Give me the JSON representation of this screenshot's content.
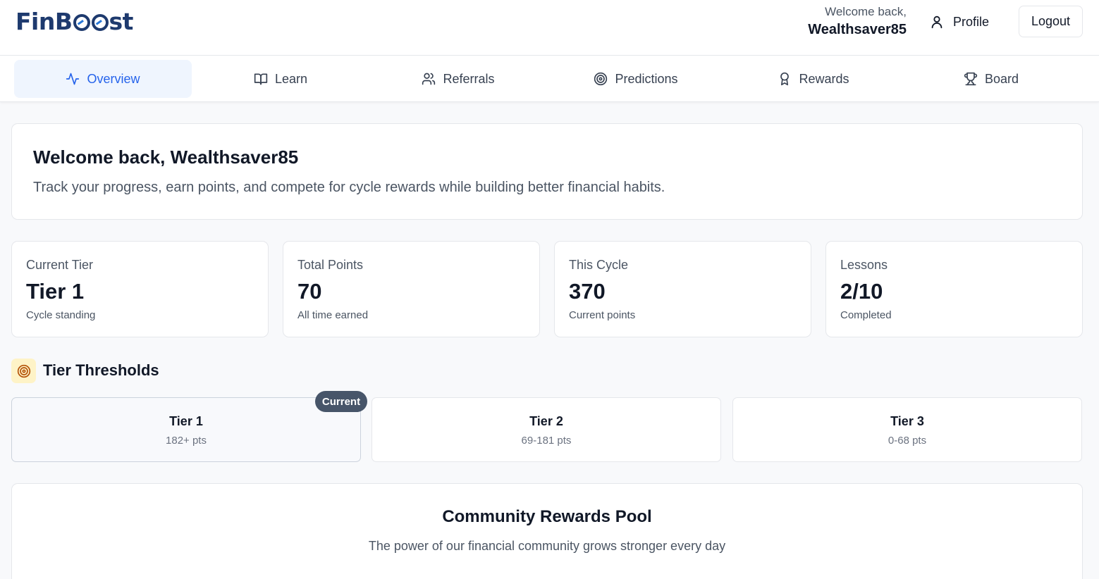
{
  "header": {
    "logo_text": "FinBoost",
    "welcome_label": "Welcome back,",
    "username": "Wealthsaver85",
    "profile_label": "Profile",
    "logout_label": "Logout"
  },
  "tabs": [
    {
      "label": "Overview",
      "icon": "activity-icon",
      "active": true
    },
    {
      "label": "Learn",
      "icon": "book-open-icon",
      "active": false
    },
    {
      "label": "Referrals",
      "icon": "users-icon",
      "active": false
    },
    {
      "label": "Predictions",
      "icon": "target-icon",
      "active": false
    },
    {
      "label": "Rewards",
      "icon": "award-icon",
      "active": false
    },
    {
      "label": "Board",
      "icon": "trophy-icon",
      "active": false
    }
  ],
  "welcome": {
    "title": "Welcome back, Wealthsaver85",
    "subtitle": "Track your progress, earn points, and compete for cycle rewards while building better financial habits."
  },
  "stats": [
    {
      "label": "Current Tier",
      "value": "Tier 1",
      "sub": "Cycle standing"
    },
    {
      "label": "Total Points",
      "value": "70",
      "sub": "All time earned"
    },
    {
      "label": "This Cycle",
      "value": "370",
      "sub": "Current points"
    },
    {
      "label": "Lessons",
      "value": "2/10",
      "sub": "Completed"
    }
  ],
  "tier_thresholds": {
    "title": "Tier Thresholds",
    "icon": "target-icon",
    "current_badge": "Current",
    "tiers": [
      {
        "name": "Tier 1",
        "points": "182+ pts",
        "current": true
      },
      {
        "name": "Tier 2",
        "points": "69-181 pts",
        "current": false
      },
      {
        "name": "Tier 3",
        "points": "0-68 pts",
        "current": false
      }
    ]
  },
  "community_pool": {
    "title": "Community Rewards Pool",
    "subtitle": "The power of our financial community grows stronger every day"
  },
  "colors": {
    "brand": "#1e3a6e",
    "accent": "#2563eb",
    "active_tab_bg": "#eff5fe",
    "badge_bg": "#475569",
    "tier_icon_bg": "#fef3c7"
  }
}
